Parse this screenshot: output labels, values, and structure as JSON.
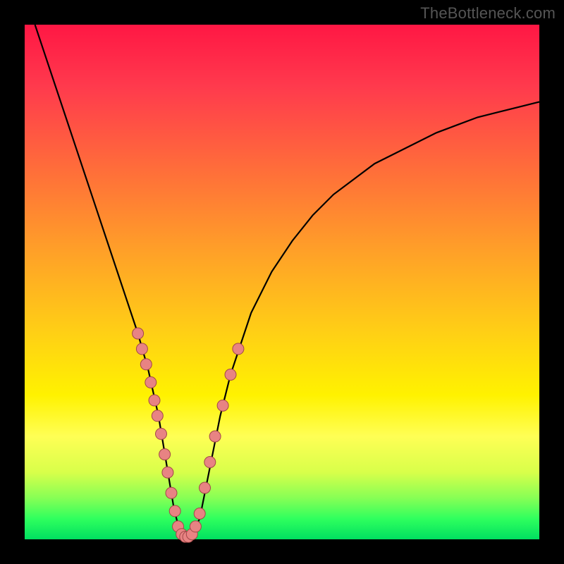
{
  "watermark": "TheBottleneck.com",
  "colors": {
    "frame": "#000000",
    "curve_stroke": "#000000",
    "dot_fill": "#e88383",
    "dot_stroke": "#a14747"
  },
  "chart_data": {
    "type": "line",
    "title": "",
    "xlabel": "",
    "ylabel": "",
    "xlim": [
      0,
      100
    ],
    "ylim": [
      0,
      100
    ],
    "series": [
      {
        "name": "curve",
        "x": [
          2,
          4,
          6,
          8,
          10,
          12,
          14,
          16,
          18,
          20,
          22,
          24,
          26,
          27,
          28,
          29,
          30,
          31,
          32,
          34,
          36,
          38,
          40,
          44,
          48,
          52,
          56,
          60,
          64,
          68,
          72,
          76,
          80,
          84,
          88,
          92,
          96,
          100
        ],
        "y": [
          100,
          94,
          88,
          82,
          76,
          70,
          64,
          58,
          52,
          46,
          40,
          33,
          24,
          18,
          12,
          6,
          2,
          0,
          0,
          4,
          14,
          24,
          32,
          44,
          52,
          58,
          63,
          67,
          70,
          73,
          75,
          77,
          79,
          80.5,
          82,
          83,
          84,
          85
        ]
      }
    ],
    "dots": {
      "left_cluster_x_range": [
        22,
        29
      ],
      "right_cluster_x_range": [
        33,
        40
      ],
      "bottom_cluster_x_range": [
        29,
        33
      ],
      "points": [
        {
          "x": 22.0,
          "y": 40.0
        },
        {
          "x": 22.8,
          "y": 37.0
        },
        {
          "x": 23.6,
          "y": 34.0
        },
        {
          "x": 24.5,
          "y": 30.5
        },
        {
          "x": 25.2,
          "y": 27.0
        },
        {
          "x": 25.8,
          "y": 24.0
        },
        {
          "x": 26.5,
          "y": 20.5
        },
        {
          "x": 27.2,
          "y": 16.5
        },
        {
          "x": 27.8,
          "y": 13.0
        },
        {
          "x": 28.5,
          "y": 9.0
        },
        {
          "x": 29.2,
          "y": 5.5
        },
        {
          "x": 29.8,
          "y": 2.5
        },
        {
          "x": 30.5,
          "y": 1.0
        },
        {
          "x": 31.2,
          "y": 0.5
        },
        {
          "x": 31.8,
          "y": 0.5
        },
        {
          "x": 32.5,
          "y": 1.0
        },
        {
          "x": 33.2,
          "y": 2.5
        },
        {
          "x": 34.0,
          "y": 5.0
        },
        {
          "x": 35.0,
          "y": 10.0
        },
        {
          "x": 36.0,
          "y": 15.0
        },
        {
          "x": 37.0,
          "y": 20.0
        },
        {
          "x": 38.5,
          "y": 26.0
        },
        {
          "x": 40.0,
          "y": 32.0
        },
        {
          "x": 41.5,
          "y": 37.0
        }
      ]
    },
    "dot_radius_px": 8
  }
}
